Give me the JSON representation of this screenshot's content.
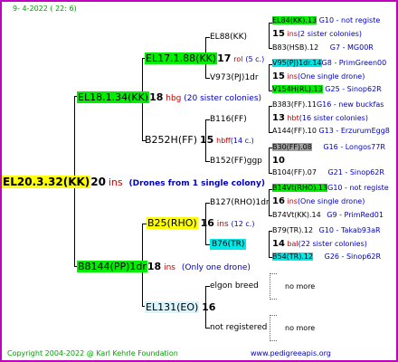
{
  "header": {
    "date": "9-  4-2022 (  22:  6)"
  },
  "footer": {
    "copyright": "Copyright 2004-2022 @ Karl Kehrle Foundation",
    "website": "www.pedigreeapis.org"
  },
  "colors": {
    "border": "#c000c0",
    "green": "#00ee00",
    "cyan": "#00e8e8",
    "yellow": "#ffff00",
    "gray": "#a0a0a0"
  },
  "root": {
    "label": "EL20.3.32(KK)",
    "num": "20",
    "ins": "ins",
    "note": "(Drones from 1 single colony)"
  },
  "gen1": {
    "upper": {
      "label": "EL18.1.34(KK)",
      "num": "18",
      "ins": "hbg",
      "note": "(20 sister colonies)"
    },
    "lower": {
      "label": "B8144(PP)1dr",
      "num": "18",
      "ins": "ins",
      "note": "(Only one drone)"
    }
  },
  "gen2": {
    "a": {
      "label": "EL17.1.88(KK)",
      "num": "17",
      "ins": "rol",
      "note": "(5 c.)"
    },
    "b": {
      "label": "B252H(FF)",
      "num": "15",
      "ins": "hbff",
      "note": "(14 c.)"
    },
    "c": {
      "label": "B25(RHO)",
      "num": "16",
      "ins": "ins",
      "note": "(12 c.)"
    },
    "d": {
      "label": "EL131(EO)",
      "num": "16"
    }
  },
  "gen3": {
    "a": {
      "label": "EL88(KK)"
    },
    "b": {
      "label": "V973(PJ)1dr"
    },
    "c": {
      "label": "B116(FF)"
    },
    "d": {
      "label": "B152(FF)ggp",
      "num": "10"
    },
    "e": {
      "label": "B127(RHO)1dr"
    },
    "f": {
      "label": "B76(TR)"
    },
    "g": {
      "label": "elgon breed"
    },
    "h": {
      "label": "not registered"
    }
  },
  "gen4": {
    "r1": {
      "label": "EL84(KK).13",
      "info": "G10 - not registe"
    },
    "r2": {
      "num": "15",
      "ins": "ins",
      "note": "(2 sister colonies)"
    },
    "r3": {
      "label": "B83(HSB).12",
      "info": "G7 - MG00R"
    },
    "r4": {
      "label": "V95(PJ)1dr.14",
      "info": "G8 - PrimGreen00"
    },
    "r5": {
      "num": "15",
      "ins": "ins",
      "note": "(One single drone)"
    },
    "r6": {
      "label": "V154H(RL).13",
      "info": "G25 - Sinop62R"
    },
    "r7": {
      "label": "B383(FF).11",
      "info": "G16 - new buckfas"
    },
    "r8": {
      "num": "13",
      "ins": "hbt",
      "note": "(16 sister colonies)"
    },
    "r9": {
      "label": "A144(FF).10",
      "info": "G13 - ErzurumEgg8"
    },
    "r10": {
      "label": "B30(FF).08",
      "info": "G16 - Longos77R"
    },
    "r11": {
      "num": "10"
    },
    "r12": {
      "label": "B104(FF).07",
      "info": "G21 - Sinop62R"
    },
    "r13": {
      "label": "B14Vt(RHO).13",
      "info": "G10 - not registe"
    },
    "r14": {
      "num": "16",
      "ins": "ins",
      "note": "(One single drone)"
    },
    "r15": {
      "label": "B74Vt(KK).14",
      "info": "G9 - PrimRed01"
    },
    "r16": {
      "label": "B79(TR).12",
      "info": "G10 - Takab93aR"
    },
    "r17": {
      "num": "14",
      "ins": "bal",
      "note": "(22 sister colonies)"
    },
    "r18": {
      "label": "B54(TR).12",
      "info": "G26 - Sinop62R"
    },
    "r19": {
      "label": "no more"
    },
    "r20": {
      "label": "no more"
    }
  }
}
